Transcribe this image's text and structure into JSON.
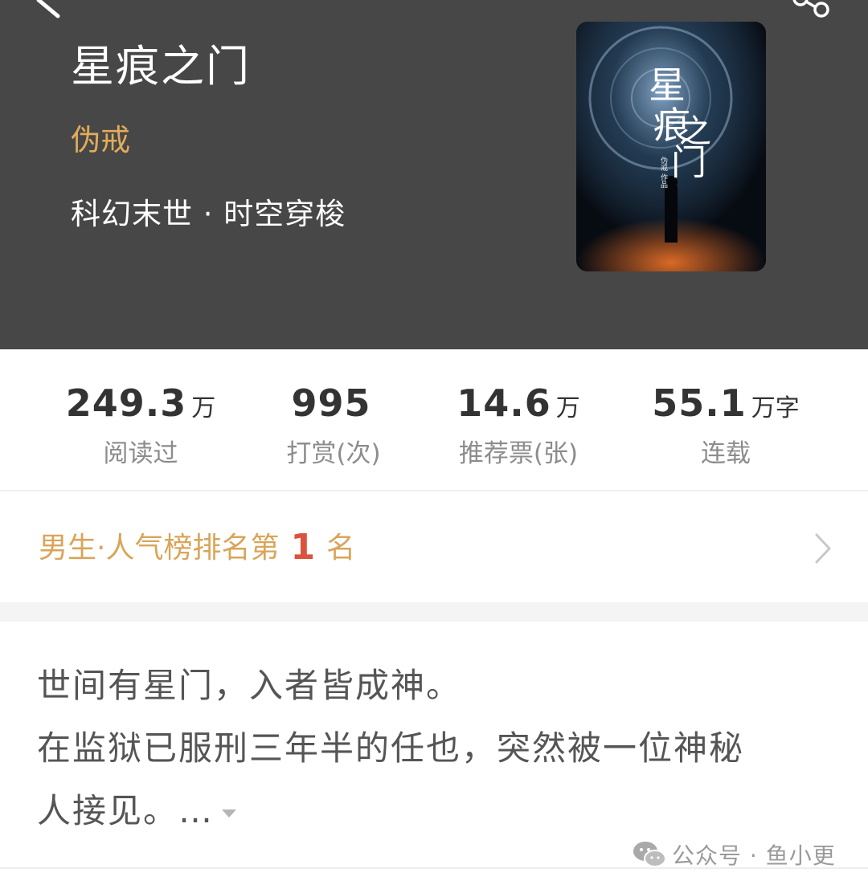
{
  "book": {
    "title": "星痕之门",
    "author": "伪戒",
    "genre": "科幻末世 · 时空穿梭",
    "cover": {
      "title_text": "星痕之门",
      "byline": "伪戒 作品"
    }
  },
  "stats": [
    {
      "value": "249.3",
      "unit": "万",
      "label": "阅读过"
    },
    {
      "value": "995",
      "unit": "",
      "label": "打赏(次)"
    },
    {
      "value": "14.6",
      "unit": "万",
      "label": "推荐票(张)"
    },
    {
      "value": "55.1",
      "unit": "万字",
      "label": "连载"
    }
  ],
  "ranking": {
    "prefix": "男生·人气榜排名第",
    "rank": "1",
    "suffix": "名"
  },
  "synopsis": {
    "line1": "世间有星门，入者皆成神。",
    "line2": "在监狱已服刑三年半的任也，突然被一位神秘",
    "line3": "人接见。…"
  },
  "watermark": "公众号 · 鱼小更",
  "icons": {
    "back": "back-arrow-icon",
    "share": "share-icon",
    "chevron": "chevron-right-icon",
    "expand": "expand-triangle-icon",
    "wechat": "wechat-icon"
  },
  "colors": {
    "header_bg": "#474747",
    "author": "#e2ac5a",
    "ranking_text": "#d9a55a",
    "ranking_number": "#d9533e",
    "stat_label": "#8c8c8c"
  }
}
